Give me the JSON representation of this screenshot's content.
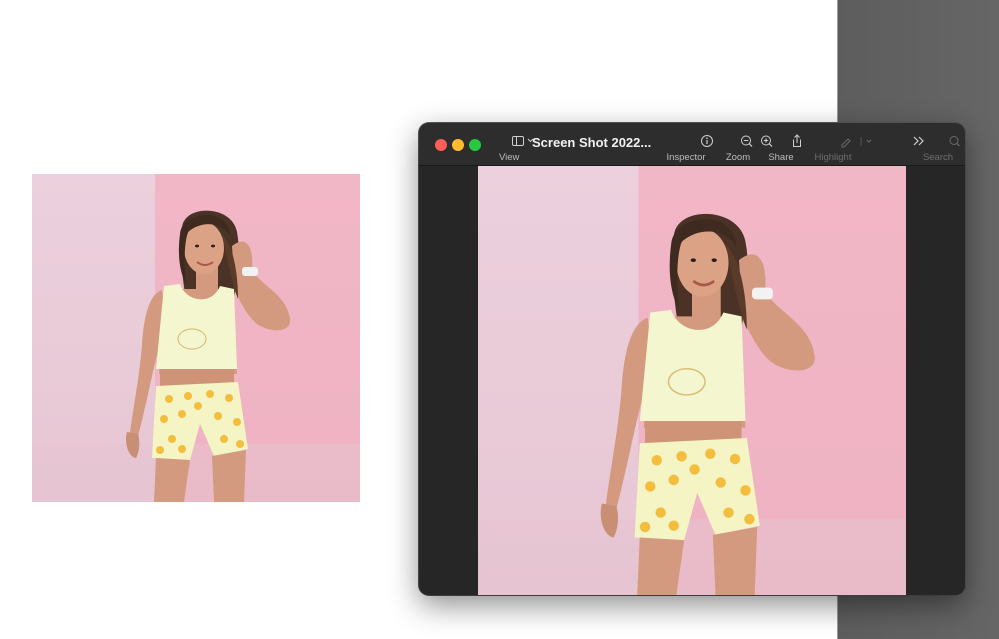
{
  "window": {
    "title": "Screen Shot 2022...",
    "toolbar": {
      "view_label": "View",
      "inspector_label": "Inspector",
      "zoom_label": "Zoom",
      "share_label": "Share",
      "highlight_label": "Highlight",
      "search_label": "Search"
    }
  },
  "icons": {
    "sidebar": "sidebar-icon",
    "inspector": "info-icon",
    "zoom_out": "zoom-out-icon",
    "zoom_in": "zoom-in-icon",
    "share": "share-icon",
    "highlight": "highlighter-icon",
    "more": "chevron-double-right-icon",
    "search": "search-icon"
  },
  "colors": {
    "window_bg": "#262626",
    "toolbar_bg": "#2d2d2d",
    "close": "#fe5f57",
    "minimize": "#febc2e",
    "zoom": "#28c840",
    "wall_pink": "#f2b8c6"
  }
}
